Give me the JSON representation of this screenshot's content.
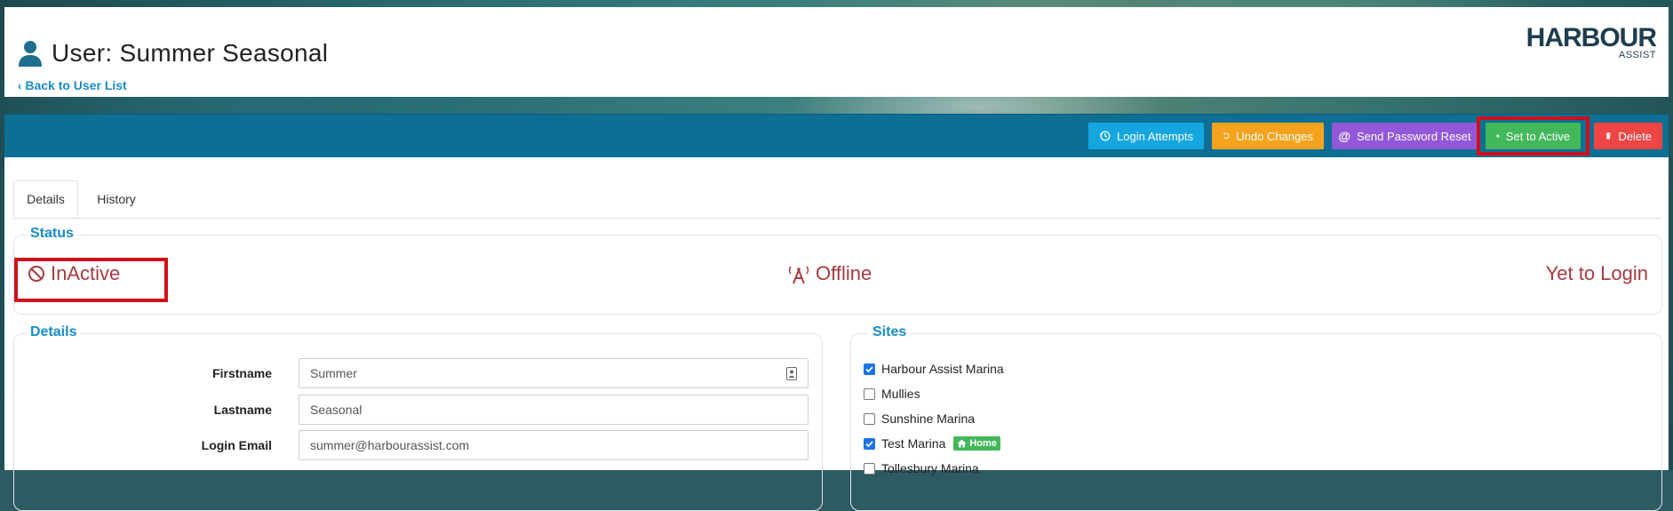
{
  "header": {
    "title": "User: Summer Seasonal",
    "back_label": "Back to User List",
    "logo_main": "HARBOUR",
    "logo_sub": "ASSIST"
  },
  "toolbar": {
    "login_attempts": "Login Attempts",
    "undo_changes": "Undo Changes",
    "send_password_reset": "Send Password Reset",
    "set_to_active": "Set to Active",
    "delete": "Delete"
  },
  "tabs": [
    {
      "label": "Details",
      "active": true
    },
    {
      "label": "History",
      "active": false
    }
  ],
  "status": {
    "legend": "Status",
    "activity": "InActive",
    "connection": "Offline",
    "login_state": "Yet to Login"
  },
  "details": {
    "legend": "Details",
    "fields": [
      {
        "label": "Firstname",
        "value": "Summer"
      },
      {
        "label": "Lastname",
        "value": "Seasonal"
      },
      {
        "label": "Login Email",
        "value": "summer@harbourassist.com"
      }
    ]
  },
  "sites": {
    "legend": "Sites",
    "items": [
      {
        "label": "Harbour Assist Marina",
        "checked": true
      },
      {
        "label": "Mullies",
        "checked": false
      },
      {
        "label": "Sunshine Marina",
        "checked": false
      },
      {
        "label": "Test Marina",
        "checked": true,
        "badge": "Home"
      },
      {
        "label": "Tollesbury Marina",
        "checked": false
      }
    ]
  },
  "colors": {
    "toolbar": "#0e6f95",
    "login_attempts": "#15a6e0",
    "undo_changes": "#f5a31e",
    "send_password_reset": "#9258d9",
    "set_to_active": "#43b75b",
    "delete": "#ef4545",
    "status_text": "#a83a40",
    "link": "#1a8bc6",
    "highlight": "#d0101a"
  }
}
